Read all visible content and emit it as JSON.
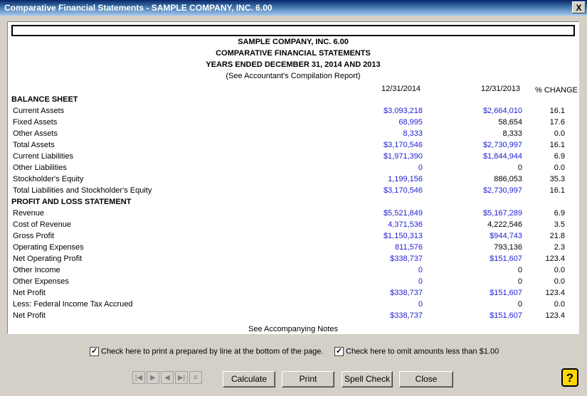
{
  "window": {
    "title": "Comparative Financial Statements - SAMPLE COMPANY, INC. 6.00",
    "close_glyph": "X"
  },
  "report": {
    "company": "SAMPLE COMPANY, INC. 6.00",
    "statement_title": "COMPARATIVE FINANCIAL STATEMENTS",
    "period": "YEARS ENDED DECEMBER 31, 2014 AND 2013",
    "note": "(See Accountant's Compilation Report)",
    "columns": {
      "current": "12/31/2014",
      "prior": "12/31/2013",
      "change": "% CHANGE"
    },
    "balance_sheet_header": "BALANCE SHEET",
    "balance_sheet": [
      {
        "label": "Current Assets",
        "current": "$3,093,218",
        "prior": "$2,664,010",
        "change": "16.1"
      },
      {
        "label": "Fixed Assets",
        "current": "68,995",
        "prior": "58,654",
        "change": "17.6"
      },
      {
        "label": "Other Assets",
        "current": "8,333",
        "prior": "8,333",
        "change": "0.0"
      },
      {
        "label": "Total Assets",
        "current": "$3,170,546",
        "prior": "$2,730,997",
        "change": "16.1"
      },
      {
        "label": "Current Liabilities",
        "current": "$1,971,390",
        "prior": "$1,844,944",
        "change": "6.9"
      },
      {
        "label": "Other Liabilities",
        "current": "0",
        "prior": "0",
        "change": "0.0"
      },
      {
        "label": "Stockholder's Equity",
        "current": "1,199,156",
        "prior": "886,053",
        "change": "35.3"
      },
      {
        "label": "Total Liabilities and Stockholder's Equity",
        "current": "$3,170,546",
        "prior": "$2,730,997",
        "change": "16.1"
      }
    ],
    "pl_header": "PROFIT AND LOSS STATEMENT",
    "profit_loss": [
      {
        "label": "Revenue",
        "current": "$5,521,849",
        "prior": "$5,167,289",
        "change": "6.9"
      },
      {
        "label": "Cost of Revenue",
        "current": "4,371,536",
        "prior": "4,222,546",
        "change": "3.5"
      },
      {
        "label": "Gross Profit",
        "current": "$1,150,313",
        "prior": "$944,743",
        "change": "21.8"
      },
      {
        "label": "Operating Expenses",
        "current": "811,576",
        "prior": "793,136",
        "change": "2.3"
      },
      {
        "label": "Net Operating Profit",
        "current": "$338,737",
        "prior": "$151,607",
        "change": "123.4"
      },
      {
        "label": "Other Income",
        "current": "0",
        "prior": "0",
        "change": "0.0"
      },
      {
        "label": "Other Expenses",
        "current": "0",
        "prior": "0",
        "change": "0.0"
      },
      {
        "label": "Net Profit",
        "current": "$338,737",
        "prior": "$151,607",
        "change": "123.4"
      },
      {
        "label": "Less: Federal Income Tax Accrued",
        "current": "0",
        "prior": "0",
        "change": "0.0"
      },
      {
        "label": "Net Profit",
        "current": "$338,737",
        "prior": "$151,607",
        "change": "123.4"
      }
    ],
    "footnote": "See Accompanying Notes"
  },
  "options": {
    "prepared_by_label": "Check here to print a prepared by line at the bottom of the page.",
    "prepared_by_checked": true,
    "omit_small_label": "Check here to omit amounts less than $1.00",
    "omit_small_checked": true,
    "check_glyph": "✓"
  },
  "nav": {
    "first": "|◀",
    "prev": "▶",
    "back": "◀",
    "last": "▶|",
    "list": "≡"
  },
  "buttons": {
    "calculate": "Calculate",
    "print": "Print",
    "spell_check": "Spell Check",
    "close": "Close",
    "help": "?"
  },
  "colors": {
    "link_blue": "#1f1fd6",
    "help_yellow": "#ffd800",
    "title_bar": "#0a246a"
  }
}
